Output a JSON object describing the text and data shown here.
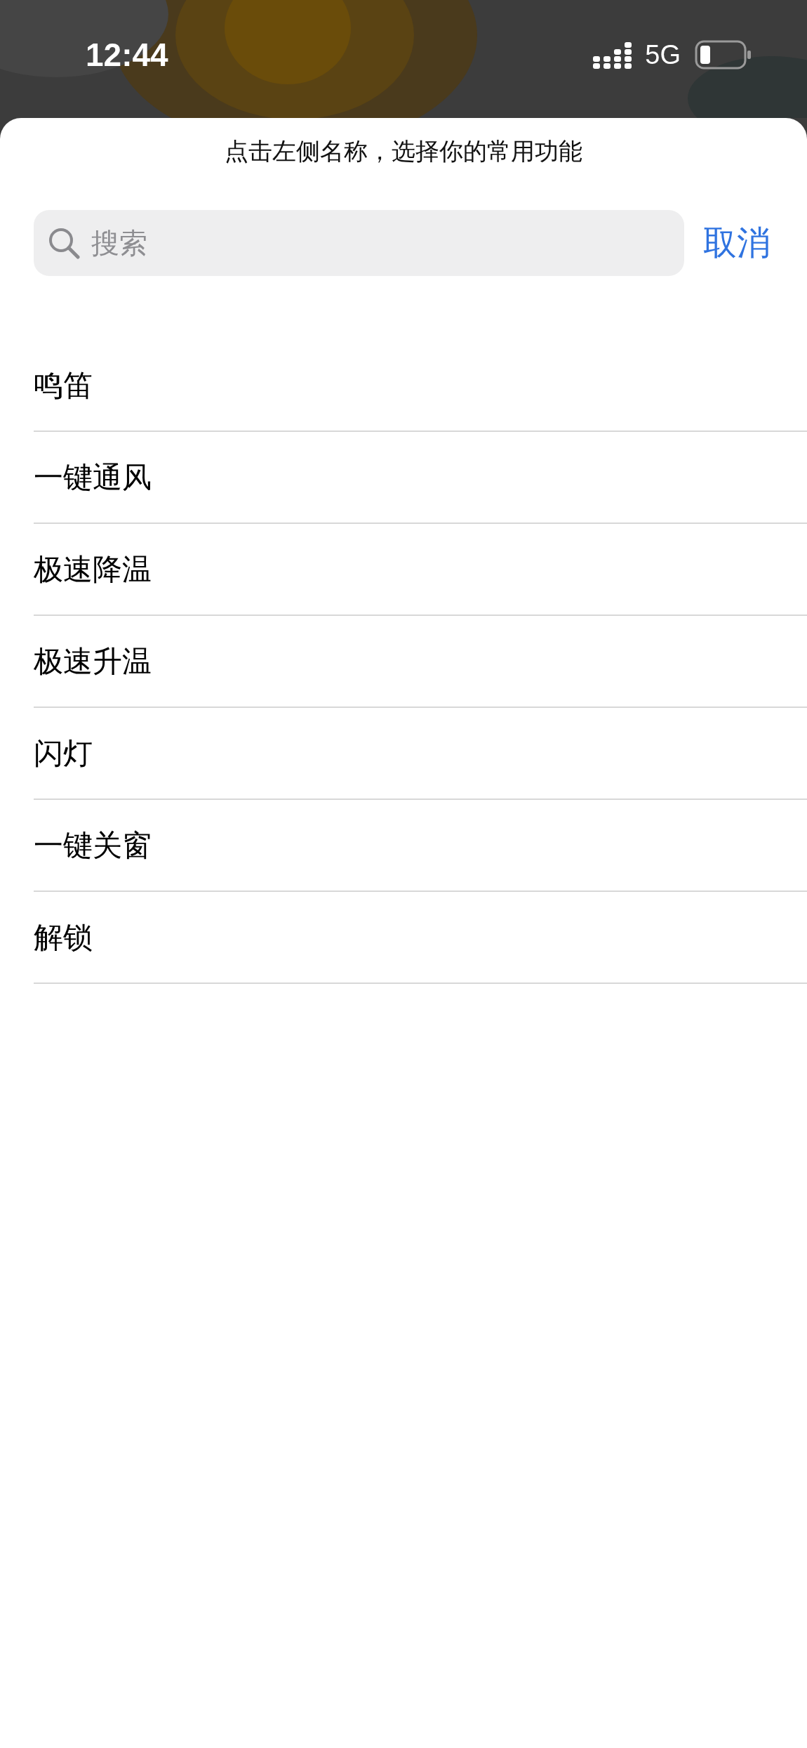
{
  "status_bar": {
    "time": "12:44",
    "network": "5G"
  },
  "sheet": {
    "hint": "点击左侧名称，选择你的常用功能",
    "search": {
      "placeholder": "搜索"
    },
    "cancel": "取消"
  },
  "items": [
    {
      "label": "鸣笛"
    },
    {
      "label": "一键通风"
    },
    {
      "label": "极速降温"
    },
    {
      "label": "极速升温"
    },
    {
      "label": "闪灯"
    },
    {
      "label": "一键关窗"
    },
    {
      "label": "解锁"
    }
  ]
}
